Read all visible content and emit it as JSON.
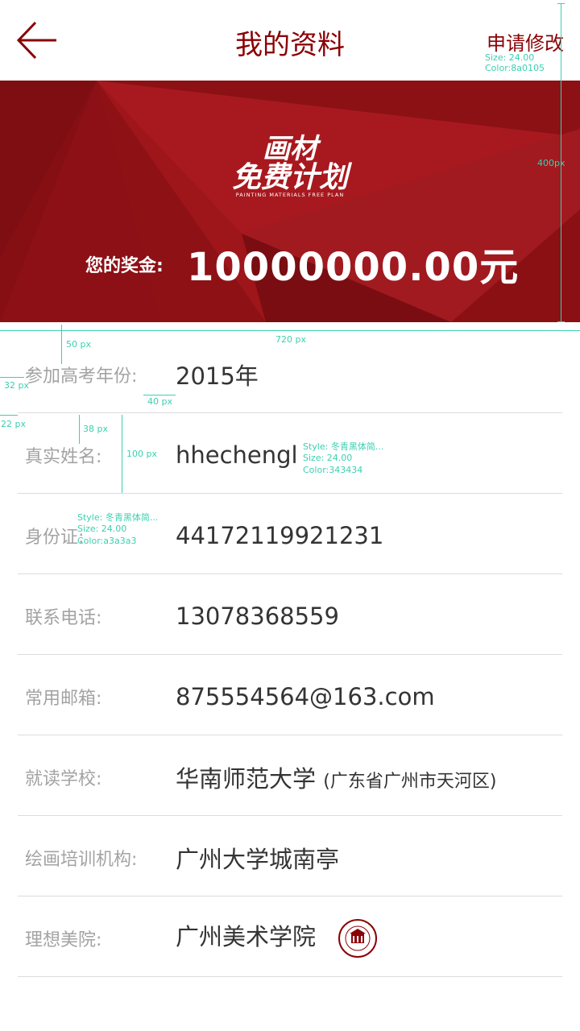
{
  "header": {
    "title": "我的资料",
    "apply_label": "申请修改",
    "apply_anno_size": "Size: 24.00",
    "apply_anno_color": "Color:8a0105"
  },
  "banner": {
    "logo_line1": "画材",
    "logo_line2": "免费计划",
    "logo_sub": "PAINTING MATERIALS FREE PLAN",
    "prize_label": "您的奖金:",
    "prize_value": "10000000.00元"
  },
  "annotations": {
    "h400": "400px",
    "w720": "720 px",
    "g50": "50 px",
    "g32": "32 px",
    "g40": "40 px",
    "g22": "22 px",
    "g38": "38 px",
    "g100": "100 px",
    "value_style": "Style: 冬青黑体简...",
    "value_size": "Size: 24.00",
    "value_color": "Color:343434",
    "label_style": "Style: 冬青黑体简...",
    "label_size": "Size: 24.00",
    "label_color": "Color:a3a3a3"
  },
  "profile": [
    {
      "label": "参加高考年份:",
      "value": "2015年"
    },
    {
      "label": "真实姓名:",
      "value": "hhechengl"
    },
    {
      "label": "身份证:",
      "value": "44172119921231"
    },
    {
      "label": "联系电话:",
      "value": "13078368559"
    },
    {
      "label": "常用邮箱:",
      "value": "875554564@163.com"
    },
    {
      "label": "就读学校:",
      "value": "华南师范大学",
      "sub": "(广东省广州市天河区)"
    },
    {
      "label": "绘画培训机构:",
      "value": "广州大学城南亭"
    },
    {
      "label": "理想美院:",
      "value": "广州美术学院"
    }
  ],
  "colors": {
    "accent": "#8a0105",
    "label": "#a3a3a3",
    "value": "#343434"
  },
  "icons": {
    "back": "back-arrow-icon",
    "emblem": "academy-emblem-icon"
  }
}
